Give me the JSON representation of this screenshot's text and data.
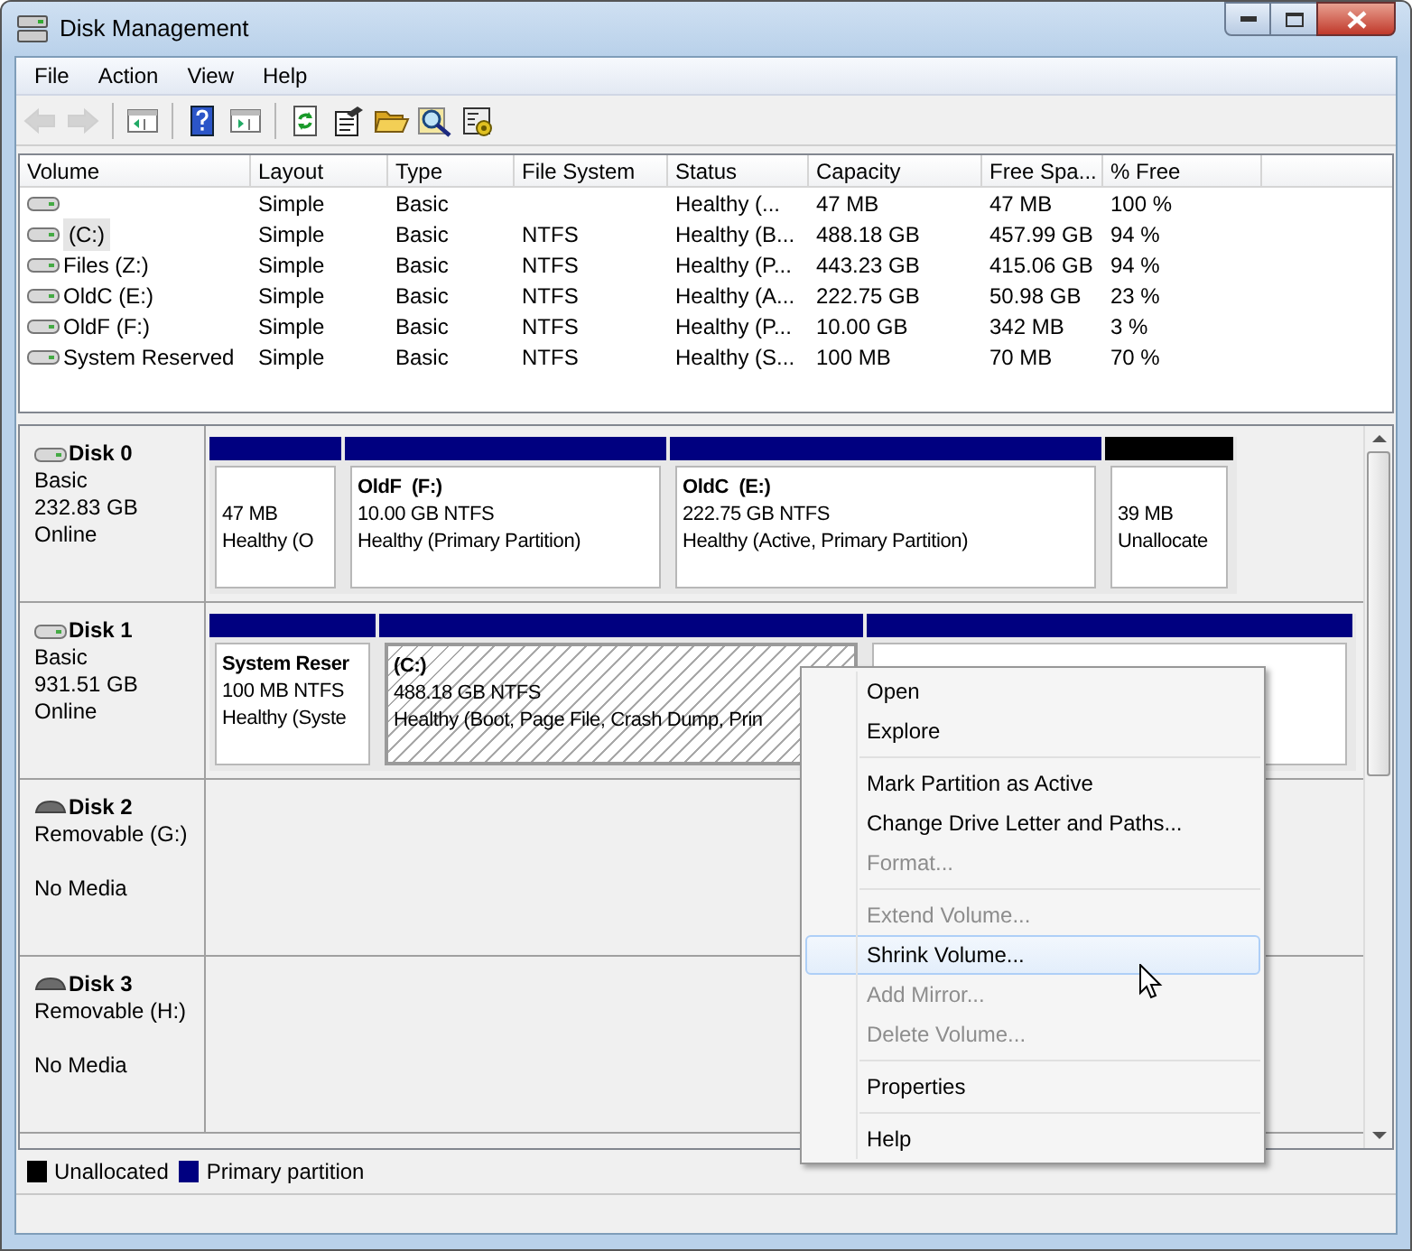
{
  "window": {
    "title": "Disk Management"
  },
  "menu": [
    "File",
    "Action",
    "View",
    "Help"
  ],
  "toolbar": [
    {
      "kind": "back",
      "disabled": true
    },
    {
      "kind": "forward",
      "disabled": true
    },
    {
      "kind": "sep"
    },
    {
      "kind": "tree",
      "disabled": false
    },
    {
      "kind": "sep"
    },
    {
      "kind": "help",
      "disabled": false
    },
    {
      "kind": "pane",
      "disabled": false
    },
    {
      "kind": "sep"
    },
    {
      "kind": "refresh",
      "disabled": false
    },
    {
      "kind": "properties",
      "disabled": false
    },
    {
      "kind": "folder",
      "disabled": false
    },
    {
      "kind": "search",
      "disabled": false
    },
    {
      "kind": "settings",
      "disabled": false
    }
  ],
  "volumes": {
    "columns": [
      "Volume",
      "Layout",
      "Type",
      "File System",
      "Status",
      "Capacity",
      "Free Spa...",
      "% Free"
    ],
    "rows": [
      {
        "selected": false,
        "cells": [
          "",
          "Simple",
          "Basic",
          "",
          "Healthy (...",
          "47 MB",
          "47 MB",
          "100 %"
        ]
      },
      {
        "selected": true,
        "cells": [
          "(C:)",
          "Simple",
          "Basic",
          "NTFS",
          "Healthy (B...",
          "488.18 GB",
          "457.99 GB",
          "94 %"
        ]
      },
      {
        "selected": false,
        "cells": [
          "Files (Z:)",
          "Simple",
          "Basic",
          "NTFS",
          "Healthy (P...",
          "443.23 GB",
          "415.06 GB",
          "94 %"
        ]
      },
      {
        "selected": false,
        "cells": [
          "OldC (E:)",
          "Simple",
          "Basic",
          "NTFS",
          "Healthy (A...",
          "222.75 GB",
          "50.98 GB",
          "23 %"
        ]
      },
      {
        "selected": false,
        "cells": [
          "OldF (F:)",
          "Simple",
          "Basic",
          "NTFS",
          "Healthy (P...",
          "10.00 GB",
          "342 MB",
          "3 %"
        ]
      },
      {
        "selected": false,
        "cells": [
          "System Reserved",
          "Simple",
          "Basic",
          "NTFS",
          "Healthy (S...",
          "100 MB",
          "70 MB",
          "70 %"
        ]
      }
    ]
  },
  "disks": [
    {
      "name": "Disk 0",
      "kind": "fixed",
      "type": "Basic",
      "size": "232.83 GB",
      "status": "Online",
      "partitions": [
        {
          "kind": "primary",
          "selected": false,
          "size": "47 MB",
          "status": "Healthy (O"
        },
        {
          "kind": "primary",
          "selected": false,
          "title": "OldF  (F:)",
          "size": "10.00 GB NTFS",
          "status": "Healthy (Primary Partition)"
        },
        {
          "kind": "primary",
          "selected": false,
          "title": "OldC  (E:)",
          "size": "222.75 GB NTFS",
          "status": "Healthy (Active, Primary Partition)"
        },
        {
          "kind": "unallocated",
          "selected": false,
          "size": "39 MB",
          "status": "Unallocate"
        }
      ]
    },
    {
      "name": "Disk 1",
      "kind": "fixed",
      "type": "Basic",
      "size": "931.51 GB",
      "status": "Online",
      "partitions": [
        {
          "kind": "primary",
          "selected": false,
          "title": "System Reser",
          "size": "100 MB NTFS",
          "status": "Healthy (Syste"
        },
        {
          "kind": "primary",
          "selected": true,
          "title": "(C:)",
          "size": "488.18 GB NTFS",
          "status": "Healthy (Boot, Page File, Crash Dump, Prin"
        },
        {
          "kind": "primary",
          "selected": false
        }
      ]
    },
    {
      "name": "Disk 2",
      "kind": "removable",
      "type": "Removable (G:)",
      "status": "No Media"
    },
    {
      "name": "Disk 3",
      "kind": "removable",
      "type": "Removable (H:)",
      "status": "No Media"
    }
  ],
  "legend": [
    {
      "label": "Unallocated",
      "color": "#000000"
    },
    {
      "label": "Primary partition",
      "color": "#000080"
    }
  ],
  "context_menu": [
    [
      {
        "label": "Open",
        "disabled": false,
        "selected": false
      },
      {
        "label": "Explore",
        "disabled": false,
        "selected": false
      }
    ],
    [
      {
        "label": "Mark Partition as Active",
        "disabled": false,
        "selected": false
      },
      {
        "label": "Change Drive Letter and Paths...",
        "disabled": false,
        "selected": false
      },
      {
        "label": "Format...",
        "disabled": true,
        "selected": false
      }
    ],
    [
      {
        "label": "Extend Volume...",
        "disabled": true,
        "selected": false
      },
      {
        "label": "Shrink Volume...",
        "disabled": false,
        "selected": true
      },
      {
        "label": "Add Mirror...",
        "disabled": true,
        "selected": false
      },
      {
        "label": "Delete Volume...",
        "disabled": true,
        "selected": false
      }
    ],
    [
      {
        "label": "Properties",
        "disabled": false,
        "selected": false
      }
    ],
    [
      {
        "label": "Help",
        "disabled": false,
        "selected": false
      }
    ]
  ]
}
